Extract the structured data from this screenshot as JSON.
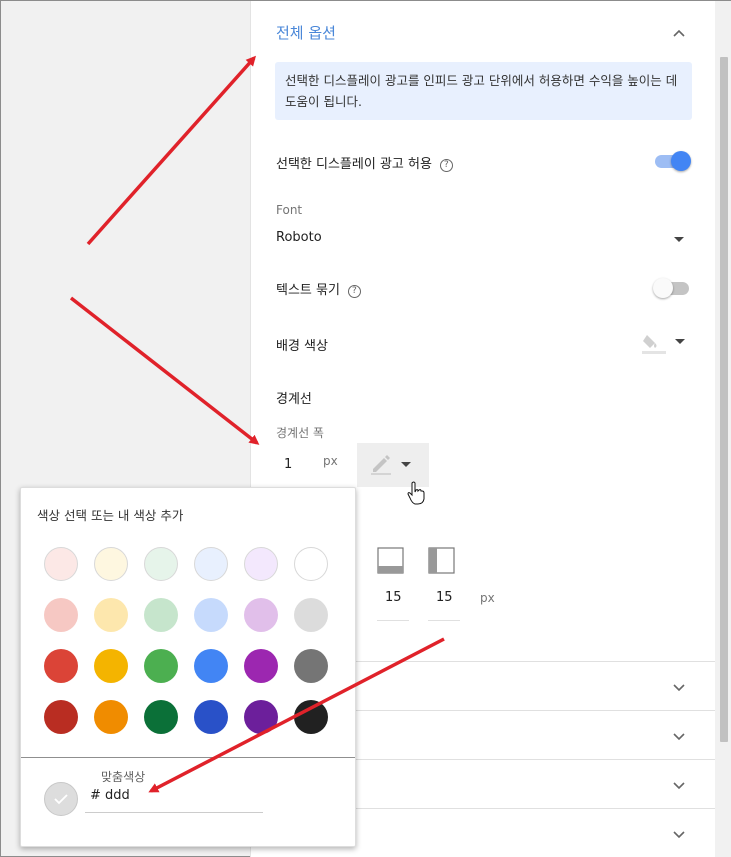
{
  "section": {
    "title": "전체 옵션",
    "info": "선택한 디스플레이 광고를 인피드 광고 단위에서 허용하면 수익을 높이는 데 도움이 됩니다."
  },
  "settings": {
    "allow_display_label": "선택한 디스플레이 광고 허용",
    "allow_display_on": true,
    "font_label": "Font",
    "font_value": "Roboto",
    "text_wrap_label": "텍스트 묶기",
    "text_wrap_on": false,
    "bg_color_label": "배경 색상",
    "border_heading": "경계선",
    "border_width_label": "경계선 폭",
    "border_width_value": "1",
    "unit_px": "px",
    "padding_bottom_value": "15",
    "padding_left_value": "15",
    "padding_unit": "px"
  },
  "color_picker": {
    "title": "색상 선택 또는 내 색상 추가",
    "swatches": [
      [
        "#fce8e6",
        "#fef7e0",
        "#e6f4ea",
        "#e8f0fe",
        "#f3e8fd",
        "#ffffff"
      ],
      [
        "#f6c8c3",
        "#fde7ad",
        "#c6e5cc",
        "#c6dafc",
        "#e1bfea",
        "#dcdcdc"
      ],
      [
        "#db4437",
        "#f4b400",
        "#4caf50",
        "#4285f4",
        "#9c27b0",
        "#757575"
      ],
      [
        "#b92d22",
        "#f08c00",
        "#0b7038",
        "#2951c8",
        "#6c1f9b",
        "#212121"
      ]
    ],
    "custom_label": "맞춤색상",
    "hex_value": "# ddd"
  },
  "colors": {
    "accent": "#4a87d8",
    "arrow": "#e0222a"
  }
}
